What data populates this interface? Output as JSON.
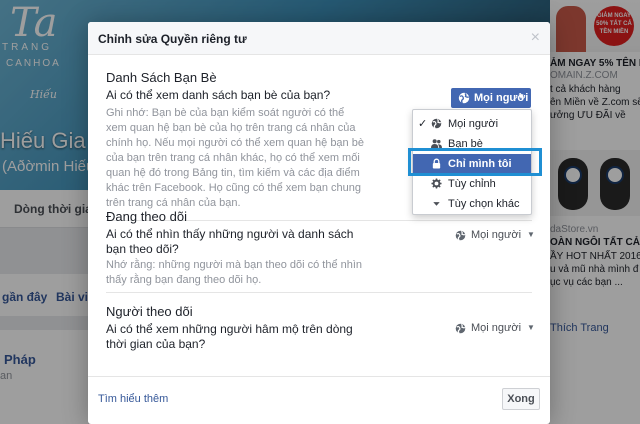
{
  "background": {
    "cover_text": [
      "Ta",
      "TRANG",
      "CANH",
      "OA"
    ],
    "cover_script": "Hiếu",
    "profile_name": "Hiếu Gia Hiếu",
    "profile_alt": "(Aðờmin Hiếu)",
    "nav_tab": "Dòng thời gian",
    "left_links": [
      "gần đây",
      "Bài viết"
    ],
    "left_person": "Pháp",
    "left_person_sub": "an",
    "ads": [
      {
        "badge": "GIẢM NGAY 50% TẤT CẢ TỀN MIỀN"
      },
      {
        "title": "ẢM NGAY 5% TÊN M",
        "domain": "OMAIN.Z.COM",
        "lines": [
          "t cả khách hàng",
          "ên Miền về Z.com sẽ",
          "ưởng ƯU ĐÃI về"
        ]
      },
      {
        "domain": "daStore.vn",
        "title": "OÀN NGÔI TẤT CẢ M",
        "lines": [
          "ẦY HOT NHẤT 2016 -",
          "u vả mũ nhà mình đ",
          "ục vụ các bạn ..."
        ]
      }
    ],
    "like_page": "Thích Trang"
  },
  "dialog": {
    "title": "Chỉnh sửa Quyền riêng tư",
    "close_glyph": "×",
    "sections": [
      {
        "title": "Danh Sách Bạn Bè",
        "question": "Ai có thể xem danh sách bạn bè của bạn?",
        "note": "Ghi nhớ: Bạn bè của bạn kiểm soát người có thể xem quan hệ bạn bè của họ trên trang cá nhân của chính họ. Nếu mọi người có thể xem quan hệ bạn bè của bạn trên trang cá nhân khác, họ có thể xem mối quan hệ đó trong Bảng tin, tìm kiếm và các địa điểm khác trên Facebook. Họ cũng có thể xem bạn chung trên trang cá nhân của bạn.",
        "audience": "Mọi người"
      },
      {
        "title": "Đang theo dõi",
        "question": "Ai có thể nhìn thấy những người và danh sách bạn theo dõi?",
        "note": "Nhớ rằng: những người mà bạn theo dõi có thể nhìn thấy rằng bạn đang theo dõi họ.",
        "audience": "Mọi người"
      },
      {
        "title": "Người theo dõi",
        "question": "Ai có thể xem những người hâm mộ trên dòng thời gian của bạn?",
        "note": "",
        "audience": "Mọi người"
      }
    ],
    "menu": {
      "items": [
        {
          "label": "Mọi người",
          "icon": "globe-icon",
          "checked": true
        },
        {
          "label": "Bạn bè",
          "icon": "friends-icon",
          "checked": false
        },
        {
          "label": "Chỉ mình tôi",
          "icon": "lock-icon",
          "checked": false,
          "selected": true
        },
        {
          "label": "Tùy chỉnh",
          "icon": "gear-icon",
          "checked": false
        },
        {
          "label": "Tùy chọn khác",
          "icon": "caret-down-icon",
          "checked": false
        }
      ],
      "check_glyph": "✓"
    },
    "footer": {
      "learn_more": "Tìm hiểu thêm",
      "done": "Xong"
    }
  },
  "colors": {
    "accent": "#4267b2",
    "highlight_box": "#1f8fd3",
    "link": "#365899"
  }
}
